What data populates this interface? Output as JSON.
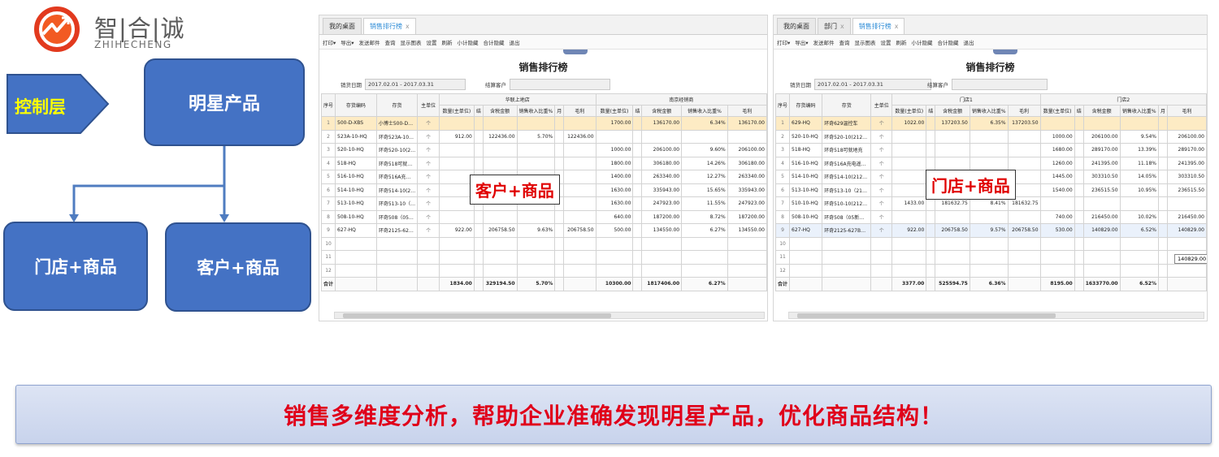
{
  "logo": {
    "cn": "智|合|诚",
    "en": "ZHIHECHENG"
  },
  "diagram": {
    "control_layer": "控制层",
    "star_product": "明星产品",
    "store_product": "门店+商品",
    "customer_product": "客户+商品"
  },
  "left_window": {
    "tabs": [
      {
        "label": "我的桌面"
      },
      {
        "label": "销售排行榜",
        "close": "x"
      }
    ],
    "toolbar": [
      "打印▾",
      "导出▾",
      "发送邮件",
      "查询",
      "显示图表",
      "设置",
      "刷新",
      "小计隐藏",
      "合计隐藏",
      "退出"
    ],
    "title": "销售排行榜",
    "filter_date_label": "销货日期",
    "filter_date_value": "2017.02.01 - 2017.03.31",
    "filter_party_label": "结算客户",
    "filter_party_value": "",
    "group_headers": [
      "华联上地店",
      "南京经销商"
    ],
    "col_headers": [
      "序号",
      "存货编码",
      "存货",
      "主单位",
      "数量(主单位)",
      "结",
      "含税金额",
      "销售收入比重%",
      "月",
      "毛利",
      "数量(主单位)",
      "结",
      "含税金额",
      "销售收入比重%",
      "毛利"
    ],
    "rows": [
      {
        "no": "1",
        "code": "500-D-XBS",
        "name": "小博士500-D…",
        "unit": "个",
        "q1": "",
        "a1": "",
        "p1": "",
        "g1": "",
        "q2": "1700.00",
        "a2": "136170.00",
        "p2": "6.34%",
        "g2": "136170.00"
      },
      {
        "no": "2",
        "code": "523A-10-HQ",
        "name": "环奇523A-10…",
        "unit": "个",
        "q1": "912.00",
        "a1": "122436.00",
        "p1": "5.70%",
        "g1": "122436.00",
        "q2": "",
        "a2": "",
        "p2": "",
        "g2": ""
      },
      {
        "no": "3",
        "code": "520-10-HQ",
        "name": "环奇520-10(2…",
        "unit": "个",
        "q1": "",
        "a1": "",
        "p1": "",
        "g1": "",
        "q2": "1000.00",
        "a2": "206100.00",
        "p2": "9.60%",
        "g2": "206100.00"
      },
      {
        "no": "4",
        "code": "518-HQ",
        "name": "环奇518可就…",
        "unit": "个",
        "q1": "",
        "a1": "",
        "p1": "",
        "g1": "",
        "q2": "1800.00",
        "a2": "306180.00",
        "p2": "14.26%",
        "g2": "306180.00"
      },
      {
        "no": "5",
        "code": "516-10-HQ",
        "name": "环奇516A充…",
        "unit": "个",
        "q1": "",
        "a1": "",
        "p1": "",
        "g1": "",
        "q2": "1400.00",
        "a2": "263340.00",
        "p2": "12.27%",
        "g2": "263340.00"
      },
      {
        "no": "6",
        "code": "514-10-HQ",
        "name": "环奇514-10(2…",
        "unit": "个",
        "q1": "",
        "a1": "",
        "p1": "",
        "g1": "",
        "q2": "1630.00",
        "a2": "335943.00",
        "p2": "15.65%",
        "g2": "335943.00"
      },
      {
        "no": "7",
        "code": "513-10-HQ",
        "name": "环奇513-10（…",
        "unit": "个",
        "q1": "",
        "a1": "",
        "p1": "",
        "g1": "",
        "q2": "1630.00",
        "a2": "247923.00",
        "p2": "11.55%",
        "g2": "247923.00"
      },
      {
        "no": "8",
        "code": "508-10-HQ",
        "name": "环奇508（05…",
        "unit": "个",
        "q1": "",
        "a1": "",
        "p1": "",
        "g1": "",
        "q2": "640.00",
        "a2": "187200.00",
        "p2": "8.72%",
        "g2": "187200.00"
      },
      {
        "no": "9",
        "code": "627-HQ",
        "name": "环奇2125-62…",
        "unit": "个",
        "q1": "922.00",
        "a1": "206758.50",
        "p1": "9.63%",
        "g1": "206758.50",
        "q2": "500.00",
        "a2": "134550.00",
        "p2": "6.27%",
        "g2": "134550.00"
      }
    ],
    "empty_rows": [
      "10",
      "11",
      "12"
    ],
    "total": {
      "label": "合计",
      "q1": "1834.00",
      "a1": "329194.50",
      "p1": "5.70%",
      "q2": "10300.00",
      "a2": "1817406.00",
      "p2": "6.27%"
    },
    "overlay": "客户+商品"
  },
  "right_window": {
    "tabs": [
      {
        "label": "我的桌面"
      },
      {
        "label": "部门",
        "close": "x"
      },
      {
        "label": "销售排行榜",
        "close": "x"
      }
    ],
    "toolbar": [
      "打印▾",
      "导出▾",
      "发送邮件",
      "查询",
      "显示图表",
      "设置",
      "刷新",
      "小计隐藏",
      "合计隐藏",
      "退出"
    ],
    "title": "销售排行榜",
    "filter_date_label": "销货日期",
    "filter_date_value": "2017.02.01 - 2017.03.31",
    "filter_party_label": "结算客户",
    "filter_party_value": "",
    "group_headers": [
      "门店1",
      "门店2"
    ],
    "col_headers": [
      "序号",
      "存货编码",
      "存货",
      "主单位",
      "数量(主单位)",
      "结",
      "含税金额",
      "销售收入比重%",
      "毛利",
      "数量(主单位)",
      "结",
      "含税金额",
      "销售收入比重%",
      "月",
      "毛利"
    ],
    "rows": [
      {
        "no": "1",
        "code": "629-HQ",
        "name": "环奇629温控车",
        "unit": "个",
        "q1": "1022.00",
        "a1": "137203.50",
        "p1": "6.35%",
        "g1": "137203.50",
        "q2": "",
        "a2": "",
        "p2": "",
        "g2": ""
      },
      {
        "no": "2",
        "code": "520-10-HQ",
        "name": "环奇520-10(212…",
        "unit": "个",
        "q1": "",
        "a1": "",
        "p1": "",
        "g1": "",
        "q2": "1000.00",
        "a2": "206100.00",
        "p2": "9.54%",
        "g2": "206100.00"
      },
      {
        "no": "3",
        "code": "518-HQ",
        "name": "环奇518可就地充",
        "unit": "个",
        "q1": "",
        "a1": "",
        "p1": "",
        "g1": "",
        "q2": "1680.00",
        "a2": "289170.00",
        "p2": "13.39%",
        "g2": "289170.00"
      },
      {
        "no": "4",
        "code": "516-10-HQ",
        "name": "环奇516A充电遥…",
        "unit": "个",
        "q1": "",
        "a1": "",
        "p1": "",
        "g1": "",
        "q2": "1260.00",
        "a2": "241395.00",
        "p2": "11.18%",
        "g2": "241395.00"
      },
      {
        "no": "5",
        "code": "514-10-HQ",
        "name": "环奇514-10(212…",
        "unit": "个",
        "q1": "",
        "a1": "",
        "p1": "",
        "g1": "",
        "q2": "1445.00",
        "a2": "303310.50",
        "p2": "14.05%",
        "g2": "303310.50"
      },
      {
        "no": "6",
        "code": "513-10-HQ",
        "name": "环奇513-10（21…",
        "unit": "个",
        "q1": "",
        "a1": "",
        "p1": "",
        "g1": "",
        "q2": "1540.00",
        "a2": "236515.50",
        "p2": "10.95%",
        "g2": "236515.50"
      },
      {
        "no": "7",
        "code": "510-10-HQ",
        "name": "环奇510-10(212…",
        "unit": "个",
        "q1": "1433.00",
        "a1": "181632.75",
        "p1": "8.41%",
        "g1": "181632.75",
        "q2": "",
        "a2": "",
        "p2": "",
        "g2": ""
      },
      {
        "no": "8",
        "code": "508-10-HQ",
        "name": "环奇508（05新…",
        "unit": "个",
        "q1": "",
        "a1": "",
        "p1": "",
        "g1": "",
        "q2": "740.00",
        "a2": "216450.00",
        "p2": "10.02%",
        "g2": "216450.00"
      },
      {
        "no": "9",
        "code": "627-HQ",
        "name": "环奇2125-627B…",
        "unit": "个",
        "q1": "922.00",
        "a1": "206758.50",
        "p1": "9.57%",
        "g1": "206758.50",
        "q2": "530.00",
        "a2": "140829.00",
        "p2": "6.52%",
        "g2": "140829.00"
      }
    ],
    "empty_rows": [
      "10",
      "11",
      "12"
    ],
    "total": {
      "label": "合计",
      "q1": "3377.00",
      "a1": "525594.75",
      "p1": "6.36%",
      "q2": "8195.00",
      "a2": "1633770.00",
      "p2": "6.52%"
    },
    "overlay": "门店+商品",
    "tooltip": "140829.00"
  },
  "banner": "销售多维度分析，帮助企业准确发现明星产品，优化商品结构！",
  "colors": {
    "box_blue": "#4472c4",
    "pentagon_yellow": "#ffff00",
    "banner_red": "#e0001a",
    "overlay_red": "#e00000",
    "tab_active": "#2a8ad6"
  }
}
